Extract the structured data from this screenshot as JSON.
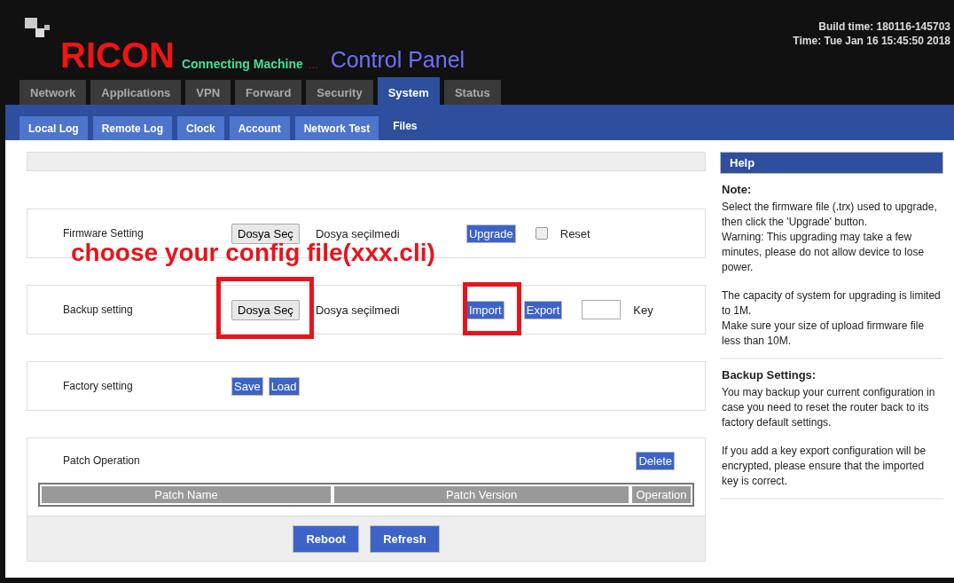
{
  "header": {
    "logo": "RICON",
    "tagline": "Connecting Machine",
    "ellipsis": "...",
    "title": "Control Panel",
    "build_time": "Build time: 180116-145703",
    "time": "Time: Tue Jan 16 15:45:50 2018"
  },
  "tabs": [
    {
      "label": "Network",
      "selected": false
    },
    {
      "label": "Applications",
      "selected": false
    },
    {
      "label": "VPN",
      "selected": false
    },
    {
      "label": "Forward",
      "selected": false
    },
    {
      "label": "Security",
      "selected": false
    },
    {
      "label": "System",
      "selected": true
    },
    {
      "label": "Status",
      "selected": false
    }
  ],
  "subtabs": [
    {
      "label": "Local Log",
      "selected": false
    },
    {
      "label": "Remote Log",
      "selected": false
    },
    {
      "label": "Clock",
      "selected": false
    },
    {
      "label": "Account",
      "selected": false
    },
    {
      "label": "Network Test",
      "selected": false
    },
    {
      "label": "Files",
      "selected": true
    }
  ],
  "sections": [
    {
      "kind": "file",
      "label": "Firmware Setting",
      "file_button": "Dosya Seç",
      "file_status": "Dosya seçilmedi",
      "buttons": [
        "Upgrade"
      ],
      "checkbox": {
        "label": "Reset",
        "checked": false
      }
    },
    {
      "kind": "file",
      "label": "Backup setting",
      "file_button": "Dosya Seç",
      "file_status": "Dosya seçilmedi",
      "buttons": [
        "Import",
        "Export"
      ],
      "key_label": "Key"
    },
    {
      "kind": "buttons",
      "label": "Factory setting",
      "buttons": [
        "Save",
        "Load"
      ]
    },
    {
      "kind": "table",
      "label": "Patch Operation",
      "buttons": [
        "Delete"
      ],
      "columns": [
        "Patch Name",
        "Patch Version",
        "Operation"
      ]
    }
  ],
  "footer_buttons": [
    "Reboot",
    "Refresh"
  ],
  "help": {
    "title": "Help",
    "sections": [
      {
        "heading": "Note:",
        "blocks": [
          [
            "Select the firmware file (.trx) used to upgrade, then click the 'Upgrade' button.",
            "Warning: This upgrading may take a few minutes, please do not allow device to lose power."
          ],
          [
            "The capacity of system for upgrading is limited to 1M.",
            "Make sure your size of upload firmware file less than 10M."
          ]
        ]
      },
      {
        "heading": "Backup Settings:",
        "blocks": [
          [
            "You may backup your current configuration in case you need to reset the router back to its factory default settings."
          ],
          [
            "If you add a key export configuration will be encrypted, please ensure that the imported key is correct."
          ]
        ]
      }
    ]
  },
  "annotations": [
    {
      "kind": "text",
      "text": "choose your config file(xxx.cli)"
    },
    {
      "kind": "box"
    },
    {
      "kind": "box"
    }
  ]
}
